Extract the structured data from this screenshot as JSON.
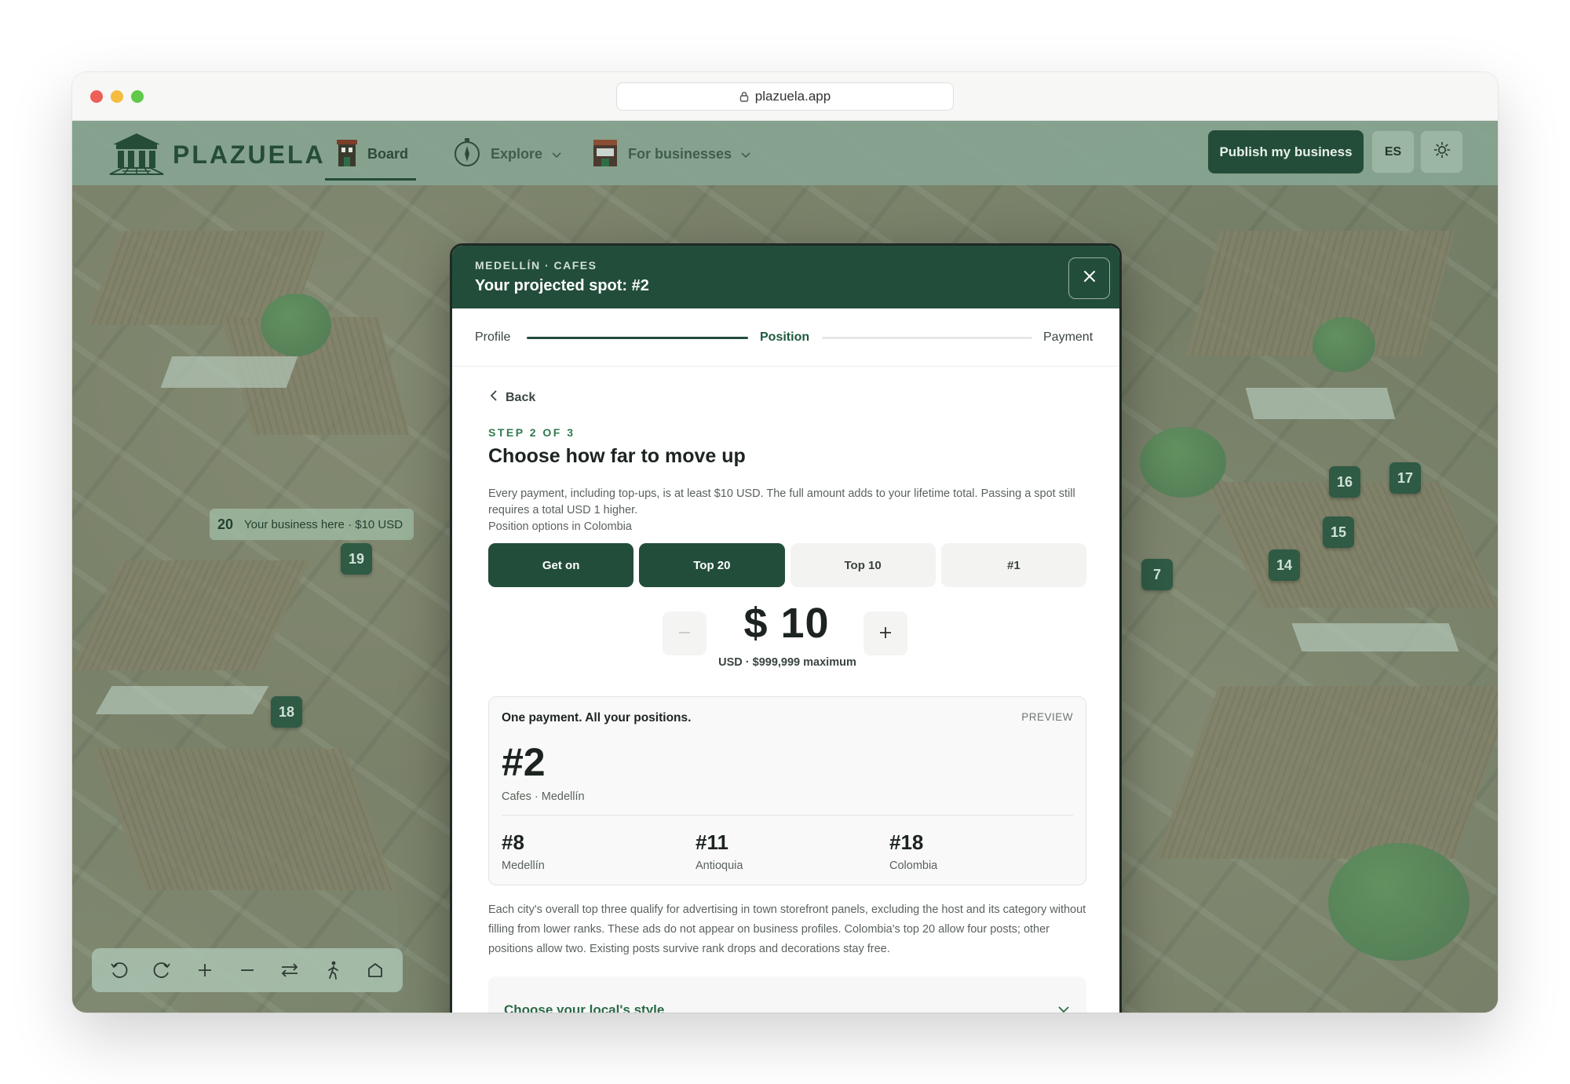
{
  "browser": {
    "url": "plazuela.app"
  },
  "nav": {
    "logo": "PLAZUELA",
    "board": "Board",
    "explore": "Explore",
    "for_businesses": "For businesses",
    "publish": "Publish my business",
    "lang": "ES"
  },
  "map": {
    "spots": [
      "20",
      "19",
      "18",
      "16",
      "17",
      "15",
      "14",
      "7"
    ],
    "tag_text": "Your business here · $10 USD"
  },
  "modal": {
    "kicker": "MEDELLÍN · CAFES",
    "title": "Your projected spot: #2",
    "steps": [
      "Profile",
      "Position",
      "Payment"
    ],
    "back": "Back",
    "step_no": "STEP 2 OF 3",
    "heading": "Choose how far to move up",
    "description": "Every payment, including top-ups, is at least $10 USD. The full amount adds to your lifetime total. Passing a spot still requires a total USD 1 higher.",
    "options_label": "Position options in Colombia",
    "options": [
      "Get on",
      "Top 20",
      "Top 10",
      "#1"
    ],
    "amount": "$ 10",
    "amount_sub": "USD · $999,999 maximum",
    "preview": {
      "title": "One payment. All your positions.",
      "tag": "PREVIEW",
      "rank": "#2",
      "rank_sub": "Cafes · Medellín",
      "cells": [
        {
          "rank": "#8",
          "label": "Medellín"
        },
        {
          "rank": "#11",
          "label": "Antioquia"
        },
        {
          "rank": "#18",
          "label": "Colombia"
        }
      ]
    },
    "footnote": "Each city's overall top three qualify for advertising in town storefront panels, excluding the host and its category without filling from lower ranks. These ads do not appear on business profiles. Colombia's top 20 allow four posts; other positions allow two. Existing posts survive rank drops and decorations stay free.",
    "style_accordion": "Choose your local's style"
  },
  "colors": {
    "brand": "#234d3b",
    "accent": "#2f7a4f"
  }
}
